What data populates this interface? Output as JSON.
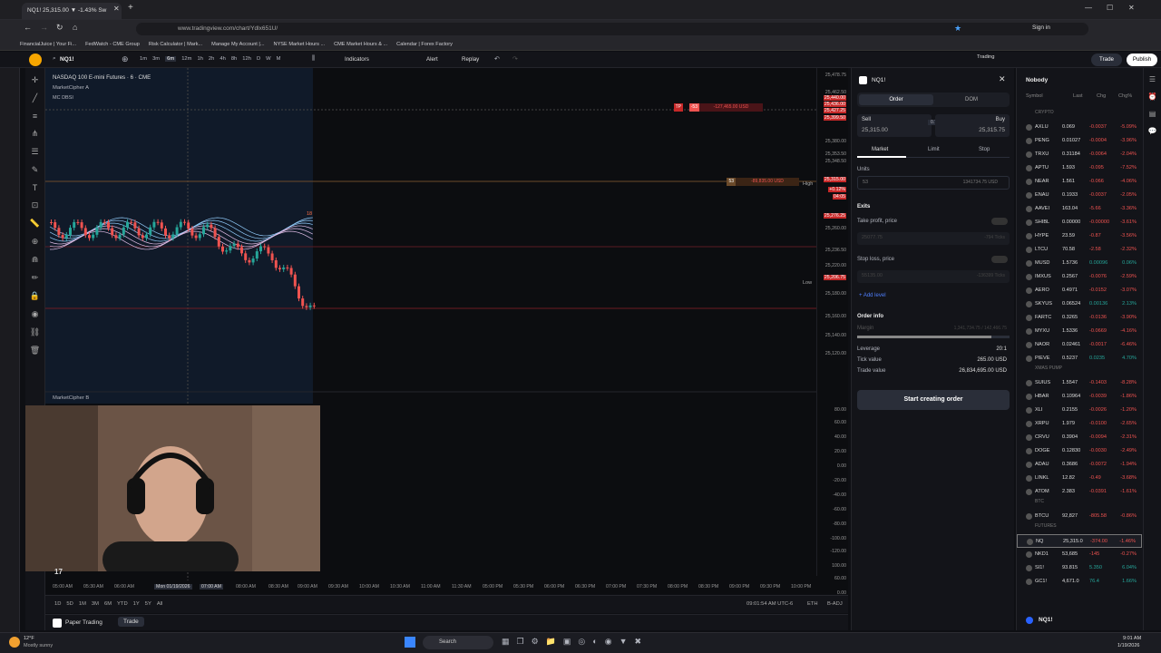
{
  "browser": {
    "tab_title": "NQ1! 25,315.00 ▼ -1.43% Sw",
    "url": "www.tradingview.com/chart/Ydlx651U/",
    "sign_in": "Sign in"
  },
  "bookmarks": [
    "FinancialJuice | Your Fi...",
    "FedWatch - CME Group",
    "Risk Calculator | Mark...",
    "Manage My Account |...",
    "NYSE Market Hours ...",
    "CME Market Hours & ...",
    "Calendar | Forex Factory"
  ],
  "toolbar": {
    "symbol": "NQ1!",
    "intervals": [
      "1m",
      "3m",
      "6m",
      "12m",
      "1h",
      "2h",
      "4h",
      "8h",
      "12h",
      "D",
      "W",
      "M"
    ],
    "active_interval": "6m",
    "indicators": "Indicators",
    "alert": "Alert",
    "replay": "Replay",
    "trading": "Trading",
    "trade": "Trade",
    "publish": "Publish"
  },
  "chart": {
    "title": "NASDAQ 100 E-mini Futures · 6 · CME",
    "indicator1": "MarketCipher A",
    "indicator1b": "MC DBSI",
    "indicator2": "MarketCipher B",
    "tp_label": "TP",
    "tp_qty": "-53",
    "tp_pnl": "-127,465.00 USD",
    "sl_qty": "53",
    "sl_pnl": "-89,835.00 USD",
    "high": "High",
    "low": "Low",
    "badge18": "18"
  },
  "price_axis": [
    "25,478.75",
    "25,462.50",
    "25,440.00",
    "25,436.00",
    "25,427.25",
    "25,399.50",
    "25,380.00",
    "25,353.50",
    "25,348.50",
    "25,315.00",
    "+0.12%",
    "04:05",
    "25,276.25",
    "25,260.00",
    "25,236.50",
    "25,220.00",
    "25,206.75",
    "25,180.00",
    "25,160.00",
    "25,140.00",
    "25,120.00"
  ],
  "osc_axis": [
    "80.00",
    "60.00",
    "40.00",
    "20.00",
    "0.00",
    "-20.00",
    "-40.00",
    "-60.00",
    "-80.00",
    "-100.00",
    "-120.00",
    "100.00",
    "60.00",
    "0.00",
    "-60.00",
    "-100.00",
    "20.00"
  ],
  "time_axis": [
    "05:00 AM",
    "05:30 AM",
    "06:00 AM",
    "06:30 AM",
    "Mon 01/19/2026",
    "07:00 AM",
    "08:00 AM",
    "08:30 AM",
    "09:00 AM",
    "09:30 AM",
    "10:00 AM",
    "10:30 AM",
    "11:00 AM",
    "11:30 AM",
    "05:00 PM",
    "05:30 PM",
    "06:00 PM",
    "06:30 PM",
    "07:00 PM",
    "07:30 PM",
    "08:00 PM",
    "08:30 PM",
    "09:00 PM",
    "09:30 PM",
    "10:00 PM"
  ],
  "range_buttons": [
    "1D",
    "5D",
    "1M",
    "3M",
    "6M",
    "YTD",
    "1Y",
    "5Y",
    "All"
  ],
  "status": {
    "clock": "09:01:54 AM UTC-6",
    "eth": "ETH",
    "badj": "B-ADJ"
  },
  "panel_tabs": [
    "Paper Trading",
    "Trade"
  ],
  "order": {
    "symbol": "NQ1!",
    "tab_order": "Order",
    "tab_dom": "DOM",
    "sell": "Sell",
    "sell_price": "25,315.00",
    "spread": "0.75",
    "buy": "Buy",
    "buy_price": "25,315.75",
    "types": [
      "Market",
      "Limit",
      "Stop"
    ],
    "units_label": "Units",
    "units": "53",
    "units_value": "1341734.75 USD",
    "exits": "Exits",
    "take_profit": "Take profit, price",
    "tp_price": "25077.75",
    "tp_ticks": "-794 Ticks",
    "stop_loss": "Stop loss, price",
    "sl_price": "55135.00",
    "sl_ticks": "-136399 Ticks",
    "add_level": "Add level",
    "order_info": "Order info",
    "margin": "Margin",
    "margin_val": "1,341,734.75 / 142,466.75",
    "leverage": "Leverage",
    "leverage_val": "20:1",
    "tick_value": "Tick value",
    "tick_value_val": "265.00 USD",
    "trade_value": "Trade value",
    "trade_value_val": "26,834,695.00 USD",
    "button": "Start creating order"
  },
  "watchlist": {
    "title": "Nobody",
    "cols": [
      "Symbol",
      "Last",
      "Chg",
      "Chg%"
    ],
    "sections": {
      "crypto": "CRYPTO",
      "xmas": "XMAS PUMP",
      "btc": "BTC",
      "futures": "FUTURES"
    },
    "rows1": [
      [
        "AXLU",
        "0.069",
        "-0.0037",
        "-5.09%",
        "neg"
      ],
      [
        "PENG",
        "0.01027",
        "-0.0004",
        "-3.96%",
        "neg"
      ],
      [
        "TRXU",
        "0.31184",
        "-0.0064",
        "-2.04%",
        "neg"
      ],
      [
        "APTU",
        "1.593",
        "-0.095",
        "-7.52%",
        "neg"
      ],
      [
        "NEAR",
        "1.561",
        "-0.066",
        "-4.06%",
        "neg"
      ],
      [
        "ENAU",
        "0.1933",
        "-0.0037",
        "-2.05%",
        "neg"
      ],
      [
        "AAVEI",
        "163.04",
        "-5.66",
        "-3.36%",
        "neg"
      ],
      [
        "SHIBL",
        "0.00000",
        "-0.00000",
        "-3.61%",
        "neg"
      ],
      [
        "HYPE",
        "23.59",
        "-0.87",
        "-3.56%",
        "neg"
      ],
      [
        "LTCU",
        "70.58",
        "-2.58",
        "-2.32%",
        "neg"
      ],
      [
        "MUSD",
        "1.5736",
        "0.00096",
        "0.06%",
        "pos"
      ],
      [
        "IMXUS",
        "0.2567",
        "-0.0076",
        "-2.59%",
        "neg"
      ],
      [
        "AERO",
        "0.4971",
        "-0.0152",
        "-3.07%",
        "neg"
      ],
      [
        "SKYUS",
        "0.06524",
        "0.00136",
        "2.13%",
        "pos"
      ],
      [
        "FARTC",
        "0.3265",
        "-0.0136",
        "-3.90%",
        "neg"
      ],
      [
        "MYXU",
        "1.5336",
        "-0.0669",
        "-4.16%",
        "neg"
      ],
      [
        "NAOR",
        "0.02461",
        "-0.0017",
        "-6.46%",
        "neg"
      ],
      [
        "PIEVE",
        "0.5237",
        "0.0235",
        "4.70%",
        "pos"
      ]
    ],
    "rows2": [
      [
        "SUIUS",
        "1.5547",
        "-0.1403",
        "-8.28%",
        "neg"
      ],
      [
        "HBAR",
        "0.10964",
        "-0.0039",
        "-1.86%",
        "neg"
      ],
      [
        "XLI",
        "0.2155",
        "-0.0026",
        "-1.20%",
        "neg"
      ],
      [
        "XRPU",
        "1.979",
        "-0.0100",
        "-2.65%",
        "neg"
      ],
      [
        "CRVU",
        "0.3904",
        "-0.0094",
        "-2.31%",
        "neg"
      ],
      [
        "DOGE",
        "0.12830",
        "-0.0030",
        "-2.49%",
        "neg"
      ],
      [
        "ADAU",
        "0.3686",
        "-0.0072",
        "-1.94%",
        "neg"
      ],
      [
        "LINKL",
        "12.82",
        "-0.49",
        "-3.68%",
        "neg"
      ],
      [
        "ATOM",
        "2.383",
        "-0.0391",
        "-1.61%",
        "neg"
      ]
    ],
    "rows3": [
      [
        "BTCU",
        "92,827",
        "-805.58",
        "-0.86%",
        "neg"
      ]
    ],
    "rows4": [
      [
        "NQ",
        "25,315.0",
        "-374.00",
        "-1.46%",
        "neg"
      ],
      [
        "NKD1",
        "53,685",
        "-145",
        "-0.27%",
        "neg"
      ],
      [
        "SI1!",
        "93.815",
        "5.350",
        "6.04%",
        "pos"
      ],
      [
        "GC1!",
        "4,671.0",
        "76.4",
        "1.66%",
        "pos"
      ]
    ],
    "footer_symbol": "NQ1!"
  },
  "taskbar": {
    "weather_temp": "12°F",
    "weather": "Mostly sunny",
    "search": "Search",
    "time": "9:01 AM",
    "date": "1/19/2026"
  },
  "colors": {
    "up": "#26a69a",
    "down": "#ef5350",
    "accent": "#2962ff",
    "bg": "#0c0d10"
  }
}
